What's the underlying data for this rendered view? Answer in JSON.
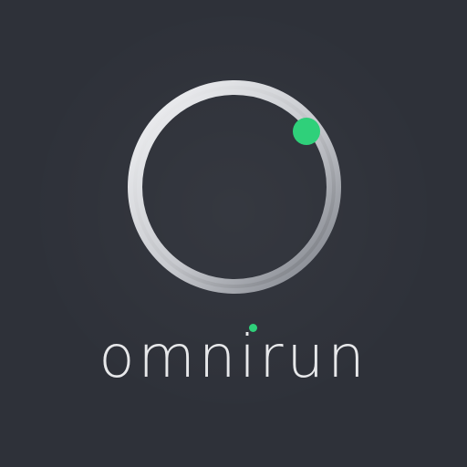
{
  "brand": {
    "wordmark": "omnirun",
    "colors": {
      "background": "#2e3139",
      "ring_light": "#f2f3f5",
      "ring_mid": "#c7c9ce",
      "ring_dark": "#7b7f87",
      "accent": "#2fd07a",
      "text": "#e7e8ea"
    },
    "icons": {
      "ring": "ring-logo-icon",
      "accent_dot": "green-dot-icon"
    }
  }
}
